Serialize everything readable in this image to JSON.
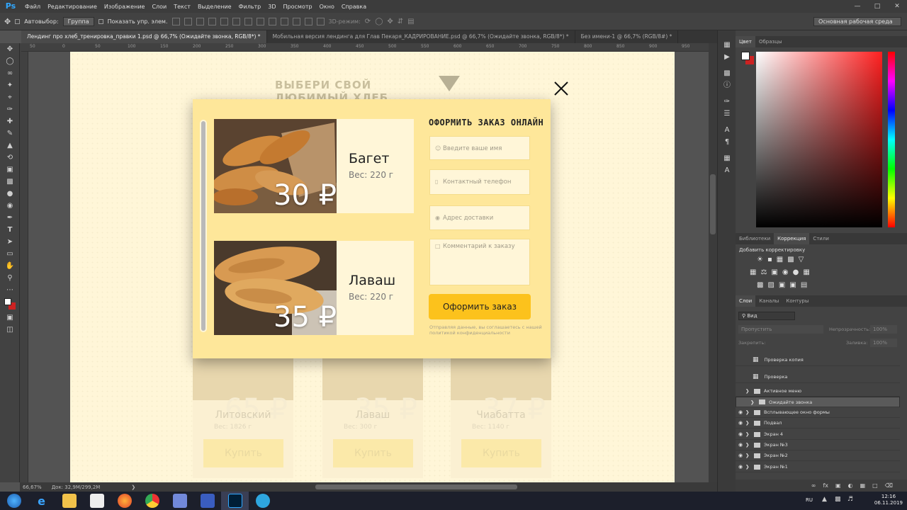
{
  "app": {
    "logo": "Ps",
    "menu": [
      "Файл",
      "Редактирование",
      "Изображение",
      "Слои",
      "Текст",
      "Выделение",
      "Фильтр",
      "3D",
      "Просмотр",
      "Окно",
      "Справка"
    ]
  },
  "options": {
    "autoselect": "Автовыбор:",
    "group": "Группа",
    "show_controls": "Показать упр. элем.",
    "mode3d": "3D-режим:",
    "workspace": "Основная рабочая среда"
  },
  "tabs": [
    "Лендинг про хлеб_тренировка_правки 1.psd @ 66,7% (Ожидайте звонка, RGB/8*) *",
    "Мобильная версия лендинга для Глав Пекаря_КАДРИРОВАНИЕ.psd @ 66,7% (Ожидайте звонка, RGB/8*) *",
    "Без имени-1 @ 66,7% (RGB/8#) *"
  ],
  "ruler": [
    "50",
    "0",
    "50",
    "100",
    "150",
    "200",
    "250",
    "300",
    "350",
    "400",
    "450",
    "500",
    "550",
    "600",
    "650",
    "700",
    "750",
    "800",
    "850",
    "900",
    "950",
    "1000"
  ],
  "canvas": {
    "section_title": "ВЫБЕРИ СВОЙ ЛЮБИМЫЙ ХЛЕБ",
    "bg_cards": [
      {
        "price": "65 ₽",
        "name": "Литовский",
        "weight": "Вес: 1826 г",
        "buy": "Купить"
      },
      {
        "price": "35 ₽",
        "name": "Лаваш",
        "weight": "Вес: 300 г",
        "buy": "Купить"
      },
      {
        "price": "37 ₽",
        "name": "Чиабатта",
        "weight": "Вес: 1140 г",
        "buy": "Купить"
      }
    ],
    "modal": {
      "items": [
        {
          "price": "30 ₽",
          "name": "Багет",
          "weight": "Вес: 220 г"
        },
        {
          "price": "35 ₽",
          "name": "Лаваш",
          "weight": "Вес: 220 г"
        }
      ],
      "form_title": "ОФОРМИТЬ ЗАКАЗ ОНЛАЙН",
      "name_ph": "Введите ваше имя",
      "phone_ph": "Контактный телефон",
      "address_ph": "Адрес доставки",
      "comment_ph": "Комментарий к заказу",
      "submit": "Оформить заказ",
      "legal": "Отправляя данные, вы соглашаетесь с нашей политикой конфиденциальности"
    }
  },
  "status": {
    "zoom": "66,67%",
    "doc": "Док: 32,9M/299,2M"
  },
  "panels": {
    "color_tabs": [
      "Цвет",
      "Образцы"
    ],
    "adj_tabs": [
      "Библиотеки",
      "Коррекция",
      "Стили"
    ],
    "adj_add": "Добавить корректировку",
    "layer_tabs": [
      "Слои",
      "Каналы",
      "Контуры"
    ],
    "layer_kind": "Вид",
    "blend": "Пропустить",
    "opacity_lbl": "Непрозрачность:",
    "opacity": "100%",
    "lock_lbl": "Закрепить:",
    "fill_lbl": "Заливка:",
    "fill": "100%",
    "layers": [
      {
        "name": "Проверка копия",
        "type": "artboard",
        "visible": false
      },
      {
        "name": "Проверка",
        "type": "artboard",
        "visible": false
      },
      {
        "name": "Активное меню",
        "type": "group",
        "visible": false
      },
      {
        "name": "Ожидайте звонка",
        "type": "group",
        "visible": false,
        "selected": true
      },
      {
        "name": "Всплывающее окно формы",
        "type": "group",
        "visible": true
      },
      {
        "name": "Подвал",
        "type": "group",
        "visible": true
      },
      {
        "name": "Экран 4",
        "type": "group",
        "visible": true
      },
      {
        "name": "Экран №3",
        "type": "group",
        "visible": true
      },
      {
        "name": "Экран №2",
        "type": "group",
        "visible": true
      },
      {
        "name": "Экран №1",
        "type": "group",
        "visible": true
      }
    ]
  },
  "taskbar": {
    "lang": "RU",
    "time": "12:16",
    "date": "06.11.2019"
  }
}
